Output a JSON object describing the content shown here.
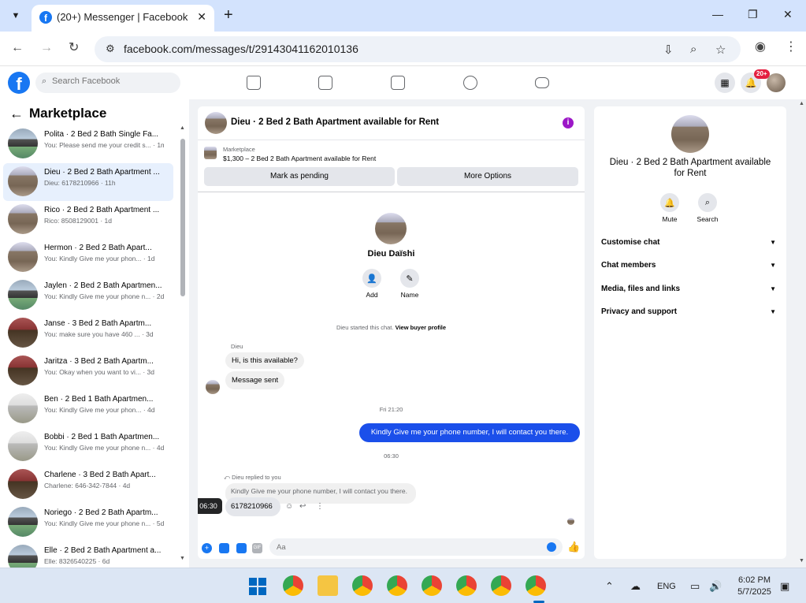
{
  "browser": {
    "tab_title": "(20+) Messenger | Facebook",
    "url": "facebook.com/messages/t/29143041162010136",
    "favicon_letter": "f"
  },
  "facebook": {
    "search_placeholder": "Search Facebook",
    "notifications_badge": "20+",
    "logo_letter": "f"
  },
  "sidebar": {
    "title": "Marketplace",
    "conversations": [
      {
        "name": "Polita · 2 Bed 2 Bath Single Fa...",
        "snippet": "You: Please send me your credit s... · 1m",
        "thumb": "house1",
        "active": false
      },
      {
        "name": "Dieu · 2 Bed 2 Bath Apartment ...",
        "snippet": "Dieu: 6178210966 · 11h",
        "thumb": "house3",
        "active": true
      },
      {
        "name": "Rico · 2 Bed 2 Bath Apartment ...",
        "snippet": "Rico: 8508129001 · 1d",
        "thumb": "house3",
        "active": false
      },
      {
        "name": "Hermon · 2 Bed 2 Bath Apart...",
        "snippet": "You: Kindly Give me your phon... · 1d",
        "thumb": "house3",
        "active": false
      },
      {
        "name": "Jaylen · 2 Bed 2 Bath Apartmen...",
        "snippet": "You: Kindly Give me your phone n... · 2d",
        "thumb": "house1",
        "active": false
      },
      {
        "name": "Janse · 3 Bed 2 Bath Apartm...",
        "snippet": "You: make sure you have 460 ... · 3d",
        "thumb": "house4",
        "active": false
      },
      {
        "name": "Jaritza · 3 Bed 2 Bath Apartm...",
        "snippet": "You: Okay when you want to vi... · 3d",
        "thumb": "house4",
        "active": false
      },
      {
        "name": "Ben · 2 Bed 1 Bath Apartmen...",
        "snippet": "You: Kindly Give me your phon... · 4d",
        "thumb": "house5",
        "active": false
      },
      {
        "name": "Bobbi · 2 Bed 1 Bath Apartmen...",
        "snippet": "You: Kindly Give me your phone n... · 4d",
        "thumb": "house5",
        "active": false
      },
      {
        "name": "Charlene · 3 Bed 2 Bath Apart...",
        "snippet": "Charlene: 646-342-7844 · 4d",
        "thumb": "house4",
        "active": false
      },
      {
        "name": "Noriego · 2 Bed 2 Bath Apartm...",
        "snippet": "You: Kindly Give me your phone n... · 5d",
        "thumb": "house1",
        "active": false
      },
      {
        "name": "Elle · 2 Bed 2 Bath Apartment a...",
        "snippet": "Elle: 8326540225 · 6d",
        "thumb": "house1",
        "active": false
      }
    ]
  },
  "chat": {
    "header_title": "Dieu · 2 Bed 2 Bath Apartment available for Rent",
    "listing_label": "Marketplace",
    "listing_price": "$1,300 – 2 Bed 2 Bath Apartment available for Rent",
    "mark_pending_label": "Mark as pending",
    "more_options_label": "More Options",
    "profile_name": "Dieu Daïshi",
    "add_label": "Add",
    "name_label": "Name",
    "started_text": "Dieu started this chat.",
    "view_buyer_label": "View buyer profile",
    "sender_label": "Dieu",
    "msg1": "Hi, is this available?",
    "msg2": "Message sent",
    "ts1": "Fri 21:20",
    "outgoing": "Kindly Give me your phone number, I will contact you there.",
    "ts2": "06:30",
    "replied_label": "Dieu replied to you",
    "quoted": "Kindly Give me your phone number, I will contact you there.",
    "phone": "6178210966",
    "tooltip_time": "06:30",
    "input_placeholder": "Aa"
  },
  "info_panel": {
    "title": "Dieu · 2 Bed 2 Bath Apartment available for Rent",
    "mute_label": "Mute",
    "search_label": "Search",
    "rows": [
      "Customise chat",
      "Chat members",
      "Media, files and links",
      "Privacy and support"
    ]
  },
  "taskbar": {
    "language": "ENG",
    "time": "6:02 PM",
    "date": "5/7/2025"
  },
  "colors": {
    "brand": "#1877f2",
    "outgoing_bubble": "#1b4fea",
    "info_icon": "#9c17c7"
  }
}
